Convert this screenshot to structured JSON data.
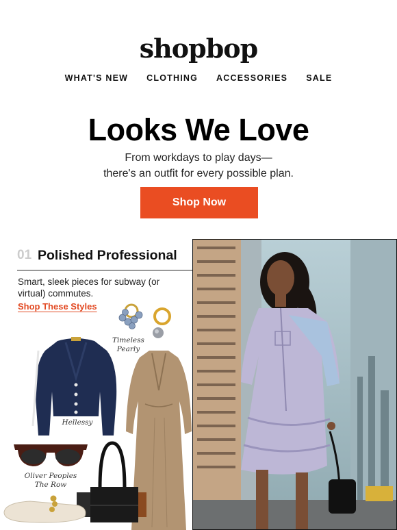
{
  "brand": {
    "logo": "shopbop"
  },
  "nav": {
    "items": [
      "WHAT'S NEW",
      "CLOTHING",
      "ACCESSORIES",
      "SALE"
    ]
  },
  "hero": {
    "headline": "Looks We Love",
    "subline_1": "From workdays to play days—",
    "subline_2": "there's an outfit for every possible plan.",
    "cta_label": "Shop Now",
    "cta_color": "#ea4d22"
  },
  "section": {
    "number": "01",
    "title": "Polished Professional",
    "description": "Smart, sleek pieces for subway (or virtual) commutes.",
    "link_label": "Shop These Styles",
    "link_color": "#e24a23"
  },
  "products": [
    {
      "caption": "Timeless Pearly",
      "icon": "earrings-icon"
    },
    {
      "caption": "Hellessy",
      "icon": "cardigan-icon"
    },
    {
      "caption": "Oliver Peoples The Row",
      "icon": "sunglasses-icon"
    },
    {
      "caption": "",
      "icon": "dress-icon"
    },
    {
      "caption": "",
      "icon": "handbag-icon"
    },
    {
      "caption": "",
      "icon": "flats-icon"
    }
  ]
}
